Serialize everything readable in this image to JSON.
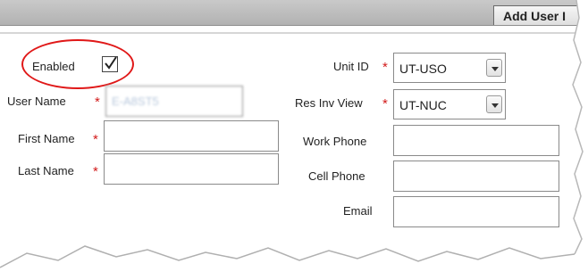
{
  "toolbar": {
    "add_user_label": "Add User I"
  },
  "form": {
    "enabled": {
      "label": "Enabled",
      "checked": true
    },
    "user_name": {
      "label": "User Name",
      "value": "E-A8ST5"
    },
    "first_name": {
      "label": "First Name",
      "value": ""
    },
    "last_name": {
      "label": "Last Name",
      "value": ""
    },
    "unit_id": {
      "label": "Unit ID",
      "value": "UT-USO"
    },
    "res_inv_view": {
      "label": "Res Inv View",
      "value": "UT-NUC"
    },
    "work_phone": {
      "label": "Work Phone",
      "value": ""
    },
    "cell_phone": {
      "label": "Cell Phone",
      "value": ""
    },
    "email": {
      "label": "Email",
      "value": ""
    },
    "required_marker": "*"
  },
  "icons": [
    "checkmark-icon",
    "dropdown-arrow-icon",
    "required-asterisk-icon"
  ],
  "colors": {
    "required": "#d21a1a",
    "highlight_circle": "#e01818",
    "toolbar": "#bdbdbd"
  }
}
